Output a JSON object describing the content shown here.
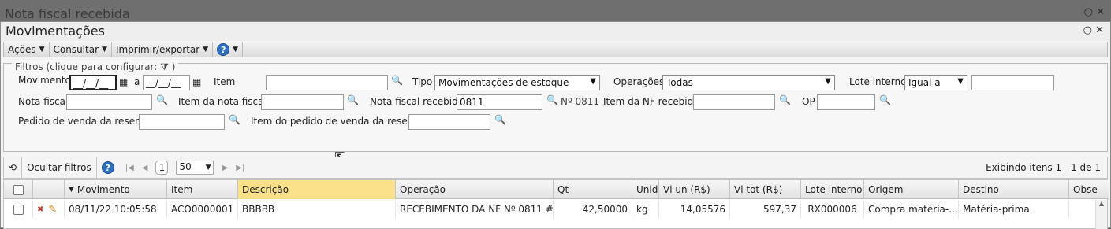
{
  "background_window": {
    "title": "Nota fiscal recebida"
  },
  "window": {
    "title": "Movimentações"
  },
  "menubar": [
    {
      "label": "Ações"
    },
    {
      "label": "Consultar"
    },
    {
      "label": "Imprimir/exportar"
    }
  ],
  "help_symbol": "?",
  "filters": {
    "legend": "Filtros (clique para configurar:",
    "legend_close": ")",
    "movimento_label": "Movimento",
    "date_from": "__/__/__",
    "date_to_label": "a",
    "date_to": "__/__/__",
    "item_label": "Item",
    "item_value": "",
    "tipo_label": "Tipo",
    "tipo_value": "Movimentações de estoque",
    "operacoes_label": "Operações",
    "operacoes_value": "Todas",
    "lote_label": "Lote interno",
    "lote_op": "Igual a",
    "lote_value": "",
    "nota_fiscal_label": "Nota fiscal",
    "item_nota_label": "Item da nota fiscal",
    "nf_recebida_label": "Nota fiscal recebida",
    "nf_recebida_value": "0811",
    "nf_recebida_hint": "Nº 0811",
    "item_nf_recebida_label": "Item da NF recebida",
    "op_label": "OP",
    "pedido_label": "Pedido de venda da reserva",
    "item_pedido_label": "Item do pedido de venda da reserva"
  },
  "toolbar": {
    "hide_filters": "Ocultar filtros",
    "page": "1",
    "page_size": "50",
    "showing": "Exibindo itens 1 - 1 de 1"
  },
  "grid": {
    "headers": [
      "Movimento",
      "Item",
      "Descrição",
      "Operação",
      "Qt",
      "Unid",
      "Vl un (R$)",
      "Vl tot (R$)",
      "Lote interno",
      "Origem",
      "Destino",
      "Obse"
    ],
    "rows": [
      {
        "movimento": "08/11/22 10:05:58",
        "item": "ACO0000001",
        "descricao": "BBBBB",
        "operacao": "RECEBIMENTO DA NF Nº 0811 #...",
        "qt": "42,50000",
        "unid": "kg",
        "vl_un": "14,05576",
        "vl_tot": "597,37",
        "lote": "RX000006",
        "origem": "Compra matéria-...",
        "destino": "Matéria-prima",
        "obse": ""
      }
    ]
  },
  "icons": {
    "dropdown": "▼",
    "close": "✕",
    "chat": "💬",
    "refresh": "⟲",
    "first": "⏮",
    "prev": "◀",
    "next": "▶",
    "last": "⏭",
    "filter": "⧩",
    "magnifier": "🔍",
    "calendar": "📅",
    "delete": "✖",
    "edit": "✎",
    "sort_desc": "▼",
    "scroll_up": "▲"
  }
}
